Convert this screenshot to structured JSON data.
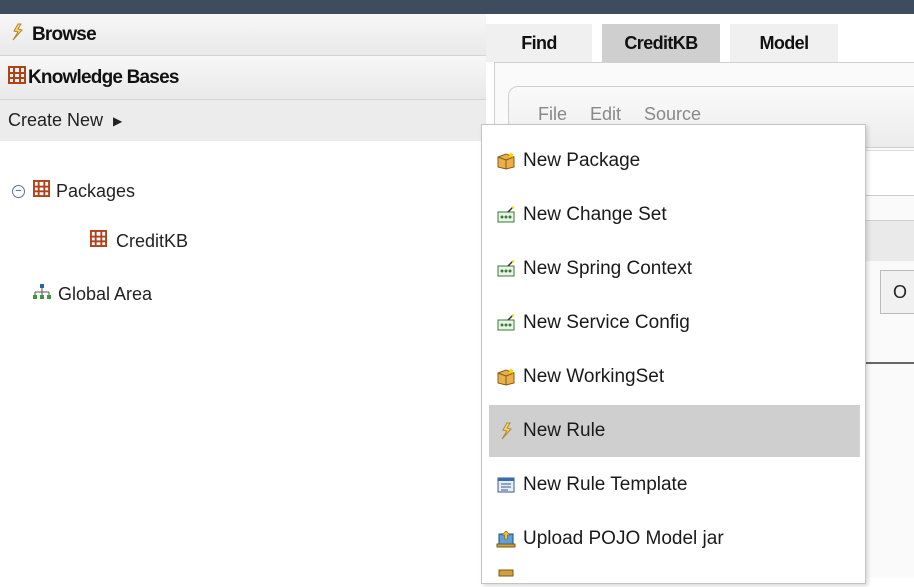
{
  "sidebar": {
    "browse_label": "Browse",
    "knowledge_bases_label": "Knowledge Bases",
    "create_new_label": "Create New",
    "tree": {
      "packages_label": "Packages",
      "creditkb_label": "CreditKB",
      "global_area_label": "Global Area"
    }
  },
  "tabs": [
    {
      "label": "Find"
    },
    {
      "label": "CreditKB"
    },
    {
      "label": "Model"
    }
  ],
  "inner_menu": {
    "text": "File Edit Source"
  },
  "o_button_label": "O",
  "dropdown": {
    "items": [
      {
        "label": "New Package",
        "icon": "package-new-icon"
      },
      {
        "label": "New Change Set",
        "icon": "change-set-icon"
      },
      {
        "label": "New Spring Context",
        "icon": "spring-context-icon"
      },
      {
        "label": "New Service Config",
        "icon": "service-config-icon"
      },
      {
        "label": "New WorkingSet",
        "icon": "workingset-icon"
      },
      {
        "label": "New Rule",
        "icon": "rule-icon",
        "selected": true
      },
      {
        "label": "New Rule Template",
        "icon": "rule-template-icon"
      },
      {
        "label": "Upload POJO Model jar",
        "icon": "upload-jar-icon"
      }
    ]
  },
  "colors": {
    "topbar": "#3d4d5d",
    "selected_item": "#cfcfcf",
    "tab_active": "#cfcfcf"
  }
}
